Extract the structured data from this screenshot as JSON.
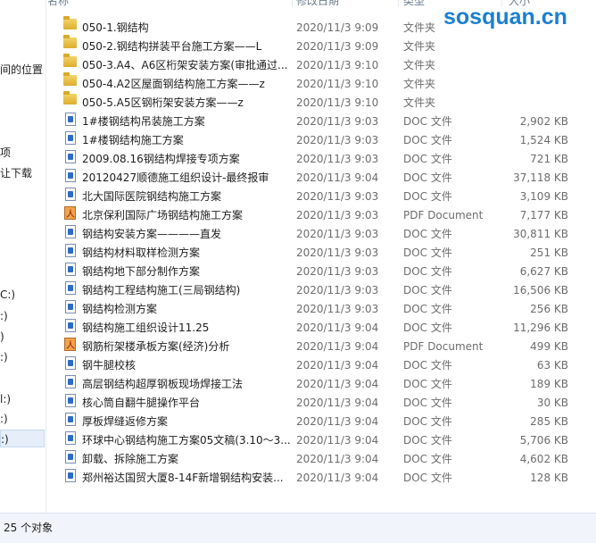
{
  "header": {
    "col_name": "名称",
    "col_date": "修改日期",
    "col_type": "类型",
    "col_size": "大小"
  },
  "watermark": "sosquan.cn",
  "nav": {
    "items": [
      "间的位置",
      "项",
      "让下载",
      "C:)",
      ":)",
      ")",
      ":)",
      "l:)",
      ":)",
      ":)"
    ]
  },
  "files": [
    {
      "name": "050-1.钢结构",
      "date": "2020/11/3 9:09",
      "type": "文件夹",
      "size": "",
      "icon": "folder-icon"
    },
    {
      "name": "050-2.钢结构拼装平台施工方案——L",
      "date": "2020/11/3 9:09",
      "type": "文件夹",
      "size": "",
      "icon": "folder-icon"
    },
    {
      "name": "050-3.A4、A6区桁架安装方案(审批通过...",
      "date": "2020/11/3 9:10",
      "type": "文件夹",
      "size": "",
      "icon": "folder-icon"
    },
    {
      "name": "050-4.A2区屋面钢结构施工方案——z",
      "date": "2020/11/3 9:10",
      "type": "文件夹",
      "size": "",
      "icon": "folder-icon"
    },
    {
      "name": "050-5.A5区钢桁架安装方案——z",
      "date": "2020/11/3 9:10",
      "type": "文件夹",
      "size": "",
      "icon": "folder-icon"
    },
    {
      "name": "1#楼钢结构吊装施工方案",
      "date": "2020/11/3 9:03",
      "type": "DOC 文件",
      "size": "2,902 KB",
      "icon": "doc-icon"
    },
    {
      "name": "1#楼钢结构施工方案",
      "date": "2020/11/3 9:03",
      "type": "DOC 文件",
      "size": "1,524 KB",
      "icon": "doc-icon"
    },
    {
      "name": "2009.08.16钢结构焊接专项方案",
      "date": "2020/11/3 9:03",
      "type": "DOC 文件",
      "size": "721 KB",
      "icon": "doc-icon"
    },
    {
      "name": "20120427顺德施工组织设计-最终报审",
      "date": "2020/11/3 9:04",
      "type": "DOC 文件",
      "size": "37,118 KB",
      "icon": "doc-icon"
    },
    {
      "name": "北大国际医院钢结构施工方案",
      "date": "2020/11/3 9:03",
      "type": "DOC 文件",
      "size": "3,109 KB",
      "icon": "doc-icon"
    },
    {
      "name": "北京保利国际广场钢结构施工方案",
      "date": "2020/11/3 9:03",
      "type": "PDF Document",
      "size": "7,177 KB",
      "icon": "pdf-icon"
    },
    {
      "name": "钢结构安装方案————直发",
      "date": "2020/11/3 9:03",
      "type": "DOC 文件",
      "size": "30,811 KB",
      "icon": "doc-icon"
    },
    {
      "name": "钢结构材料取样检测方案",
      "date": "2020/11/3 9:03",
      "type": "DOC 文件",
      "size": "251 KB",
      "icon": "doc-icon"
    },
    {
      "name": "钢结构地下部分制作方案",
      "date": "2020/11/3 9:03",
      "type": "DOC 文件",
      "size": "6,627 KB",
      "icon": "doc-icon"
    },
    {
      "name": "钢结构工程结构施工(三局钢结构)",
      "date": "2020/11/3 9:03",
      "type": "DOC 文件",
      "size": "16,506 KB",
      "icon": "doc-icon"
    },
    {
      "name": "钢结构检测方案",
      "date": "2020/11/3 9:03",
      "type": "DOC 文件",
      "size": "256 KB",
      "icon": "doc-icon"
    },
    {
      "name": "钢结构施工组织设计11.25",
      "date": "2020/11/3 9:04",
      "type": "DOC 文件",
      "size": "11,296 KB",
      "icon": "doc-icon"
    },
    {
      "name": "钢筋桁架楼承板方案(经济)分析",
      "date": "2020/11/3 9:04",
      "type": "PDF Document",
      "size": "499 KB",
      "icon": "pdf-icon"
    },
    {
      "name": "钢牛腿校核",
      "date": "2020/11/3 9:04",
      "type": "DOC 文件",
      "size": "63 KB",
      "icon": "doc-icon"
    },
    {
      "name": "高层钢结构超厚钢板现场焊接工法",
      "date": "2020/11/3 9:04",
      "type": "DOC 文件",
      "size": "189 KB",
      "icon": "doc-icon"
    },
    {
      "name": "核心筒自翻牛腿操作平台",
      "date": "2020/11/3 9:04",
      "type": "DOC 文件",
      "size": "30 KB",
      "icon": "doc-icon"
    },
    {
      "name": "厚板焊缝返修方案",
      "date": "2020/11/3 9:04",
      "type": "DOC 文件",
      "size": "285 KB",
      "icon": "doc-icon"
    },
    {
      "name": "环球中心钢结构施工方案05文稿(3.10～3...",
      "date": "2020/11/3 9:04",
      "type": "DOC 文件",
      "size": "5,706 KB",
      "icon": "doc-icon"
    },
    {
      "name": "卸载、拆除施工方案",
      "date": "2020/11/3 9:04",
      "type": "DOC 文件",
      "size": "4,602 KB",
      "icon": "doc-icon"
    },
    {
      "name": "郑州裕达国贸大厦8-14F新增钢结构安装...",
      "date": "2020/11/3 9:04",
      "type": "DOC 文件",
      "size": "128 KB",
      "icon": "doc-icon"
    }
  ],
  "status": {
    "count_text": "25 个对象"
  }
}
